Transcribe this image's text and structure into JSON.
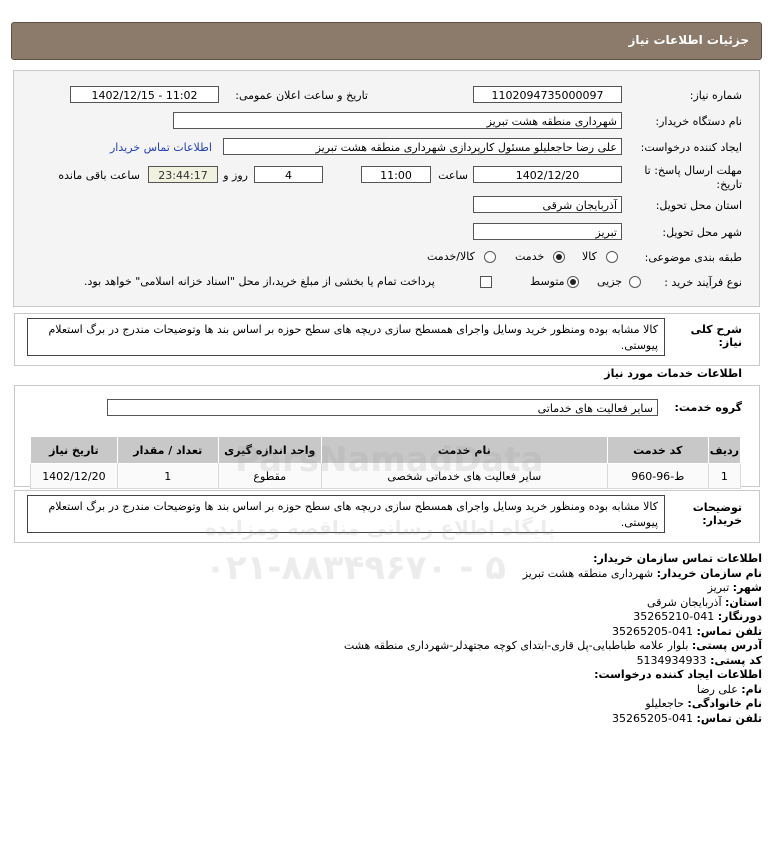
{
  "header": {
    "title": "جزئیات اطلاعات نیاز"
  },
  "form": {
    "need_number_label": "شماره نیاز:",
    "need_number": "1102094735000097",
    "announce_label": "تاریخ و ساعت اعلان عمومی:",
    "announce_value": "1402/12/15 - 11:02",
    "buyer_org_label": "نام دستگاه خریدار:",
    "buyer_org": "شهرداری منطقه هشت تبریز",
    "creator_label": "ایجاد کننده درخواست:",
    "creator": "علی رضا حاجعلیلو مسئول کارپردازی شهرداری منطقه هشت تبریز",
    "contact_link": "اطلاعات تماس خریدار",
    "deadline_label_1": "مهلت ارسال پاسخ: تا",
    "deadline_label_2": "تاریخ:",
    "deadline_date": "1402/12/20",
    "time_label": "ساعت",
    "deadline_time": "11:00",
    "days_value": "4",
    "days_label": "روز و",
    "remaining_value": "23:44:17",
    "remaining_label": "ساعت باقی مانده",
    "province_label": "استان محل تحویل:",
    "province": "آذربایجان شرقی",
    "city_label": "شهر محل تحویل:",
    "city": "تبریز",
    "category_label": "طبقه بندی موضوعی:",
    "category_options": [
      "کالا",
      "خدمت",
      "کالا/خدمت"
    ],
    "category_selected": "خدمت",
    "process_label": "نوع فرآیند خرید :",
    "process_options": [
      "جزیی",
      "متوسط"
    ],
    "process_selected": "متوسط",
    "payment_text": "پرداخت تمام یا بخشی از مبلغ خرید،از محل \"اسناد خزانه اسلامی\" خواهد بود."
  },
  "description": {
    "label": "شرح کلی نیاز:",
    "text": "کالا مشابه بوده ومنظور خرید وسایل واجرای همسطح سازی دریچه های سطح حوزه بر اساس بند ها وتوضیحات مندرج در برگ استعلام پیوستی."
  },
  "services": {
    "title": "اطلاعات خدمات مورد نیاز",
    "group_label": "گروه خدمت:",
    "group_value": "سایر فعالیت های خدماتی",
    "columns": [
      "ردیف",
      "کد خدمت",
      "نام خدمت",
      "واحد اندازه گیری",
      "تعداد / مقدار",
      "تاریخ نیاز"
    ],
    "rows": [
      [
        "1",
        "ط-96-960",
        "سایر فعالیت های خدماتی شخصی",
        "مقطوع",
        "1",
        "1402/12/20"
      ]
    ]
  },
  "buyer_notes": {
    "label": "توضیحات خریدار:",
    "text": "کالا مشابه بوده ومنظور خرید وسایل واجرای همسطح سازی دریچه های سطح حوزه بر اساس بند ها وتوضیحات مندرج در برگ استعلام پیوستی."
  },
  "contact": {
    "title": "اطلاعات تماس سازمان خریدار:",
    "org_label": "نام سازمان خریدار:",
    "org": "شهرداری منطقه هشت تبریز",
    "city_label": "شهر:",
    "city": "تبریز",
    "province_label": "استان:",
    "province": "آذربایجان شرقی",
    "fax_label": "دورنگار:",
    "fax": "041-35265210",
    "phone_label": "تلفن تماس:",
    "phone": "041-35265205",
    "address_label": "آدرس پستی:",
    "address": "بلوار علامه طباطبایی-پل قاری-ابتدای کوچه مجتهدلر-شهرداری منطقه هشت",
    "postal_label": "کد پستی:",
    "postal": "5134934933",
    "creator_title": "اطلاعات ایجاد کننده درخواست:",
    "first_name_label": "نام:",
    "first_name": "علی رضا",
    "last_name_label": "نام خانوادگی:",
    "last_name": "حاجعلیلو",
    "creator_phone_label": "تلفن تماس:",
    "creator_phone": "041-35265205"
  },
  "watermark": {
    "brand": "ParsNamadData",
    "tagline": "پایگاه اطلاع رسانی مناقصه ومزایده",
    "phone": "۰۲۱-۸۸۳۴۹۶۷۰ - ۵"
  }
}
